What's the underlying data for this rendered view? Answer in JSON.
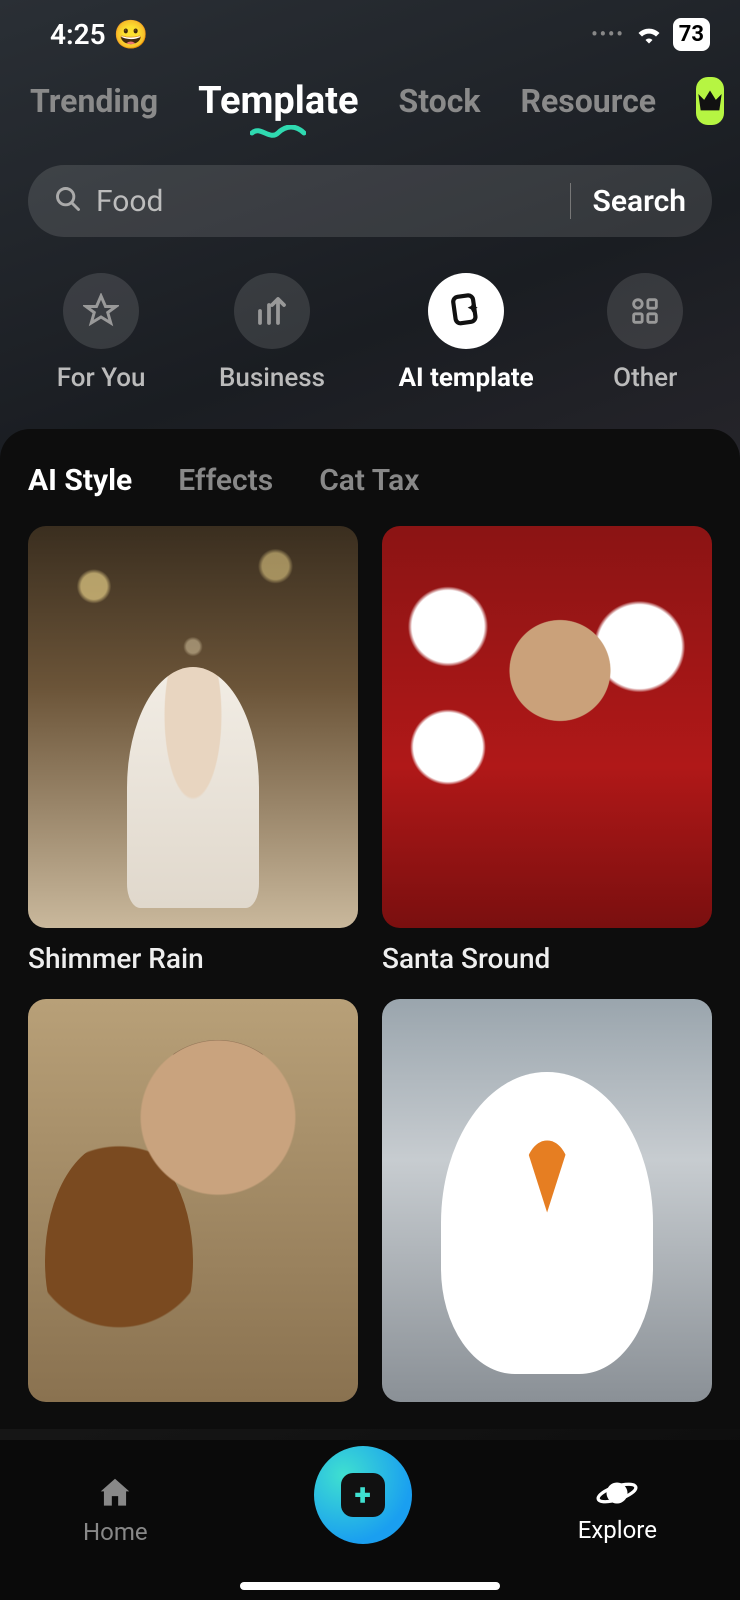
{
  "status": {
    "time": "4:25",
    "emoji": "😀",
    "battery": "73"
  },
  "topTabs": {
    "items": [
      "Trending",
      "Template",
      "Stock",
      "Resource"
    ],
    "activeIndex": 1
  },
  "search": {
    "placeholder": "Food",
    "button": "Search"
  },
  "categories": {
    "items": [
      {
        "label": "For You",
        "icon": "star"
      },
      {
        "label": "Business",
        "icon": "chart"
      },
      {
        "label": "AI template",
        "icon": "card"
      },
      {
        "label": "Other",
        "icon": "grid"
      }
    ],
    "activeIndex": 2
  },
  "subTabs": {
    "items": [
      "AI Style",
      "Effects",
      "Cat Tax"
    ],
    "activeIndex": 0
  },
  "templates": [
    {
      "title": "Shimmer Rain"
    },
    {
      "title": "Santa Sround"
    },
    {
      "title": ""
    },
    {
      "title": ""
    }
  ],
  "bottomNav": {
    "home": "Home",
    "explore": "Explore"
  }
}
